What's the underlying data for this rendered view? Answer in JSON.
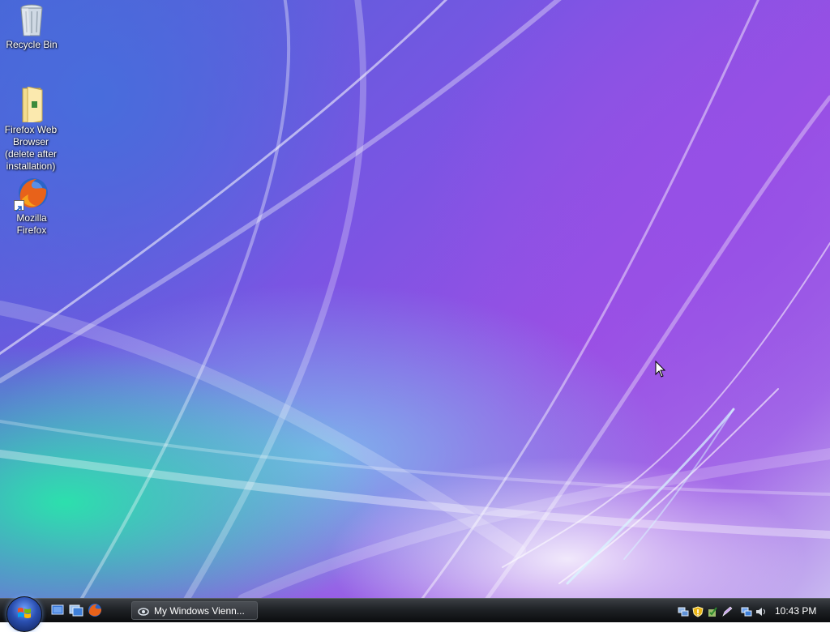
{
  "desktop": {
    "icons": [
      {
        "label": "Recycle Bin",
        "icon": "recycle-bin-icon"
      },
      {
        "label": "Firefox Web Browser (delete after installation)",
        "icon": "folder-icon"
      },
      {
        "label": "Mozilla Firefox",
        "icon": "firefox-icon"
      }
    ]
  },
  "taskbar": {
    "start_icon": "windows-orb-icon",
    "quick_launch": [
      "show-desktop-icon",
      "switch-windows-icon",
      "firefox-icon"
    ],
    "task_button": {
      "label": "My Windows Vienn...",
      "icon": "windows-viewer-icon"
    },
    "tray_icons": [
      "network-icon",
      "security-alert-icon",
      "update-icon",
      "pen-icon",
      "connection-icon",
      "volume-icon"
    ],
    "clock": "10:43 PM"
  },
  "colors": {
    "taskbar": "#1f2226",
    "wallpaper_purple": "#9b4fe4",
    "wallpaper_green": "#28e6aa"
  }
}
